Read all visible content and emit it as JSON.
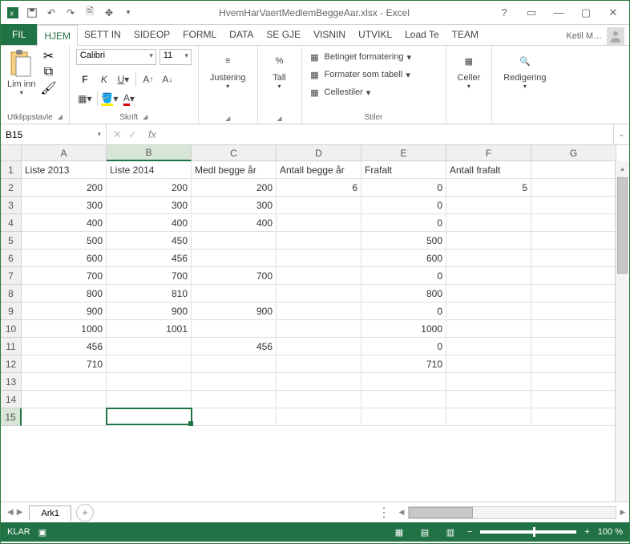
{
  "title": "HvemHarVaertMedlemBeggeAar.xlsx - Excel",
  "user": "Ketil M…",
  "tabs": {
    "fil": "FIL",
    "items": [
      "HJEM",
      "SETT IN",
      "SIDEOP",
      "FORML",
      "DATA",
      "SE GJE",
      "VISNIN",
      "UTVIKL",
      "Load Te",
      "TEAM"
    ],
    "active": 0
  },
  "ribbon": {
    "paste": "Lim inn",
    "clipboard_label": "Utklippstavle",
    "font_name": "Calibri",
    "font_size": "11",
    "font_label": "Skrift",
    "align_label": "Justering",
    "number_label": "Tall",
    "styles": {
      "cond": "Betinget formatering",
      "table": "Formater som tabell",
      "cell": "Cellestiler",
      "label": "Stiler"
    },
    "cells_label": "Celler",
    "edit_label": "Redigering"
  },
  "formula_bar": {
    "namebox": "B15",
    "fx": "fx"
  },
  "sheet": {
    "columns": [
      "A",
      "B",
      "C",
      "D",
      "E",
      "F",
      "G"
    ],
    "headers": [
      "Liste 2013",
      "Liste 2014",
      "Medl begge år",
      "Antall begge år",
      "Frafalt",
      "Antall frafalt",
      ""
    ],
    "rows": [
      [
        "200",
        "200",
        "200",
        "6",
        "0",
        "5",
        ""
      ],
      [
        "300",
        "300",
        "300",
        "",
        "0",
        "",
        ""
      ],
      [
        "400",
        "400",
        "400",
        "",
        "0",
        "",
        ""
      ],
      [
        "500",
        "450",
        "",
        "",
        "500",
        "",
        ""
      ],
      [
        "600",
        "456",
        "",
        "",
        "600",
        "",
        ""
      ],
      [
        "700",
        "700",
        "700",
        "",
        "0",
        "",
        ""
      ],
      [
        "800",
        "810",
        "",
        "",
        "800",
        "",
        ""
      ],
      [
        "900",
        "900",
        "900",
        "",
        "0",
        "",
        ""
      ],
      [
        "1000",
        "1001",
        "",
        "",
        "1000",
        "",
        ""
      ],
      [
        "456",
        "",
        "456",
        "",
        "0",
        "",
        ""
      ],
      [
        "710",
        "",
        "",
        "",
        "710",
        "",
        ""
      ],
      [
        "",
        "",
        "",
        "",
        "",
        "",
        ""
      ],
      [
        "",
        "",
        "",
        "",
        "",
        "",
        ""
      ],
      [
        "",
        "",
        "",
        "",
        "",
        "",
        ""
      ]
    ],
    "active_cell": {
      "row": 15,
      "col": "B"
    },
    "tab_name": "Ark1"
  },
  "status": {
    "ready": "KLAR",
    "zoom": "100 %"
  }
}
